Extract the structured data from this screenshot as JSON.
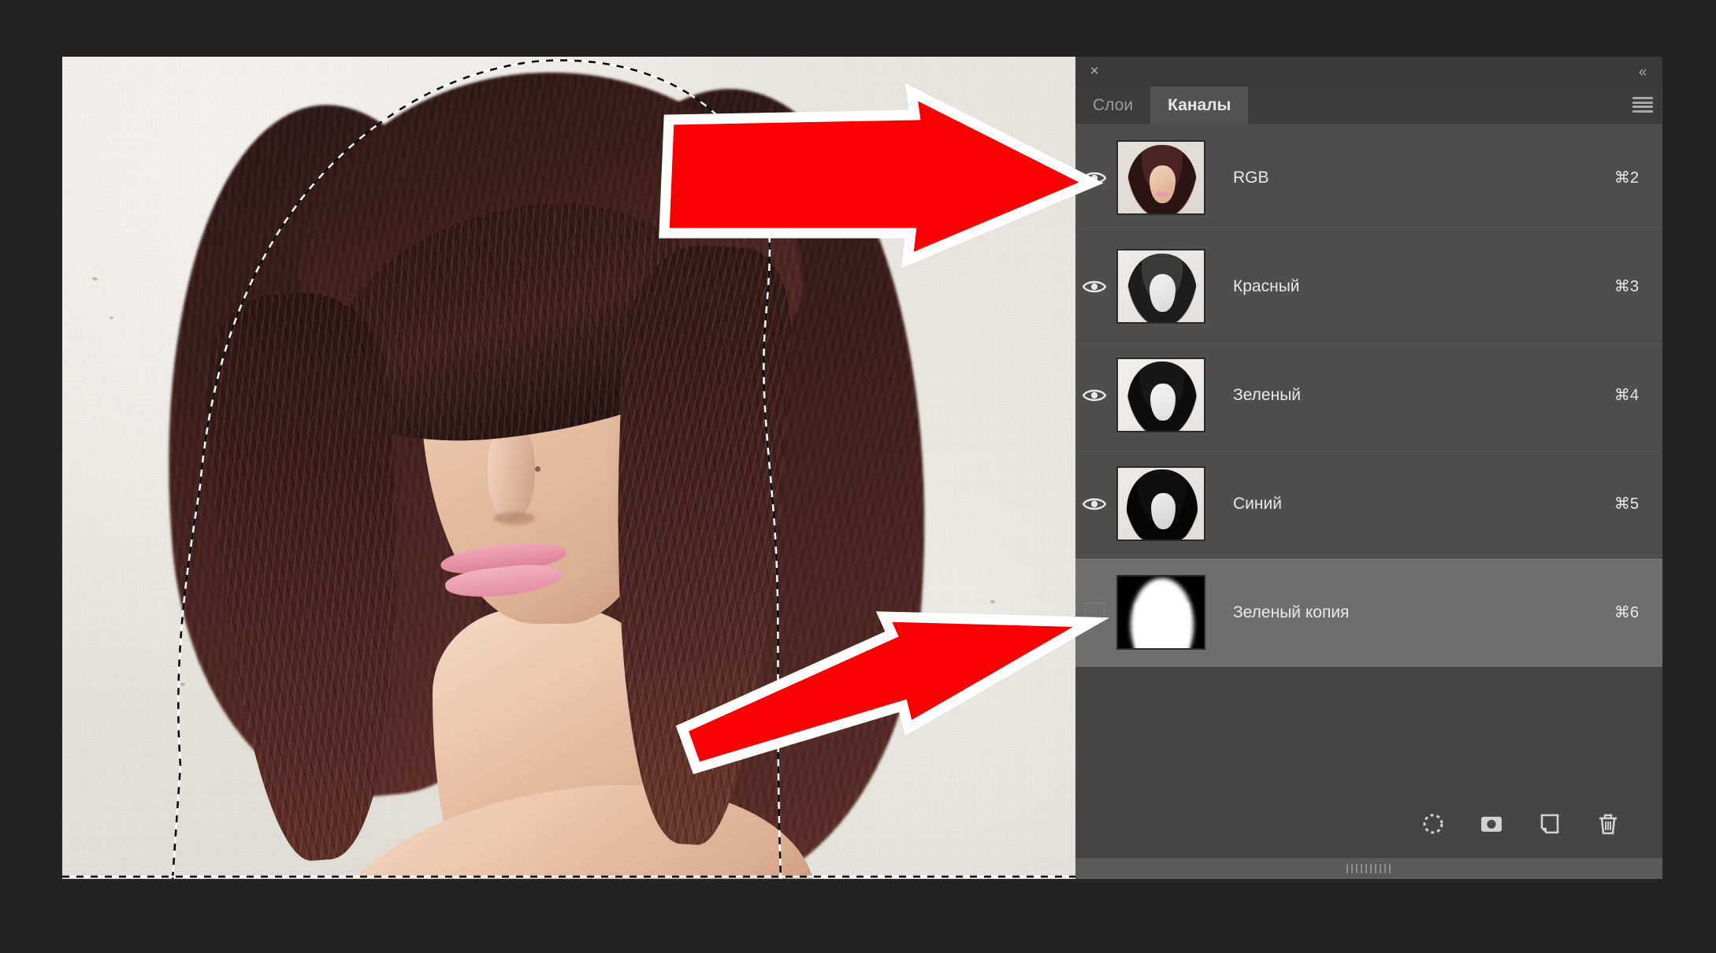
{
  "app": {
    "background_color": "#232323",
    "canvas_bg_color": "#e9e6e1"
  },
  "panel": {
    "close_label": "×",
    "collapse_label": "«",
    "menu_icon": "hamburger-menu-icon",
    "background_color": "#454545",
    "row_color": "#4e4e4e",
    "selected_row_color": "#6e6e6e",
    "tabs": [
      {
        "label": "Слои",
        "active": false
      },
      {
        "label": "Каналы",
        "active": true
      }
    ],
    "channels": [
      {
        "name": "RGB",
        "shortcut": "⌘2",
        "visible": true,
        "selected": false,
        "thumb_type": "color-portrait"
      },
      {
        "name": "Красный",
        "shortcut": "⌘3",
        "visible": true,
        "selected": false,
        "thumb_type": "grayscale-portrait-light"
      },
      {
        "name": "Зеленый",
        "shortcut": "⌘4",
        "visible": true,
        "selected": false,
        "thumb_type": "grayscale-portrait-contrast"
      },
      {
        "name": "Синий",
        "shortcut": "⌘5",
        "visible": true,
        "selected": false,
        "thumb_type": "grayscale-portrait-dark"
      },
      {
        "name": "Зеленый копия",
        "shortcut": "⌘6",
        "visible": false,
        "selected": true,
        "thumb_type": "alpha-mask-silhouette"
      }
    ],
    "footer_buttons": [
      {
        "name": "load-channel-as-selection-icon"
      },
      {
        "name": "save-selection-as-channel-icon"
      },
      {
        "name": "create-new-channel-icon"
      },
      {
        "name": "delete-channel-icon"
      }
    ],
    "resize_grip": "panel-resize-grip"
  },
  "annotations": {
    "arrow_color": "#fa0000",
    "arrow_outline_color": "#ffffff",
    "arrows": [
      {
        "name": "arrow-pointing-to-rgb-eye-icon",
        "points_to": "RGB visibility eye"
      },
      {
        "name": "arrow-pointing-to-alpha-channel-visibility-box",
        "points_to": "Зеленый копия visibility box"
      }
    ]
  },
  "document": {
    "selection_active": true,
    "selection_style": "marching-ants",
    "subject": "portrait-photograph"
  }
}
